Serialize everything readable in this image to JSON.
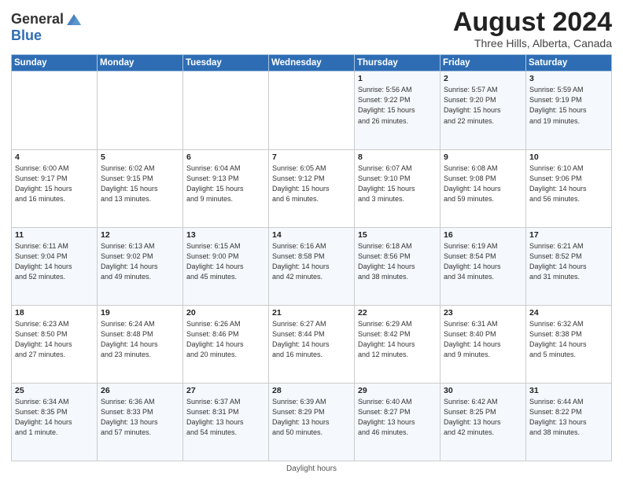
{
  "header": {
    "logo_general": "General",
    "logo_blue": "Blue",
    "main_title": "August 2024",
    "subtitle": "Three Hills, Alberta, Canada"
  },
  "footer": {
    "note": "Daylight hours"
  },
  "calendar": {
    "days_of_week": [
      "Sunday",
      "Monday",
      "Tuesday",
      "Wednesday",
      "Thursday",
      "Friday",
      "Saturday"
    ],
    "weeks": [
      [
        {
          "day": "",
          "info": ""
        },
        {
          "day": "",
          "info": ""
        },
        {
          "day": "",
          "info": ""
        },
        {
          "day": "",
          "info": ""
        },
        {
          "day": "1",
          "info": "Sunrise: 5:56 AM\nSunset: 9:22 PM\nDaylight: 15 hours\nand 26 minutes."
        },
        {
          "day": "2",
          "info": "Sunrise: 5:57 AM\nSunset: 9:20 PM\nDaylight: 15 hours\nand 22 minutes."
        },
        {
          "day": "3",
          "info": "Sunrise: 5:59 AM\nSunset: 9:19 PM\nDaylight: 15 hours\nand 19 minutes."
        }
      ],
      [
        {
          "day": "4",
          "info": "Sunrise: 6:00 AM\nSunset: 9:17 PM\nDaylight: 15 hours\nand 16 minutes."
        },
        {
          "day": "5",
          "info": "Sunrise: 6:02 AM\nSunset: 9:15 PM\nDaylight: 15 hours\nand 13 minutes."
        },
        {
          "day": "6",
          "info": "Sunrise: 6:04 AM\nSunset: 9:13 PM\nDaylight: 15 hours\nand 9 minutes."
        },
        {
          "day": "7",
          "info": "Sunrise: 6:05 AM\nSunset: 9:12 PM\nDaylight: 15 hours\nand 6 minutes."
        },
        {
          "day": "8",
          "info": "Sunrise: 6:07 AM\nSunset: 9:10 PM\nDaylight: 15 hours\nand 3 minutes."
        },
        {
          "day": "9",
          "info": "Sunrise: 6:08 AM\nSunset: 9:08 PM\nDaylight: 14 hours\nand 59 minutes."
        },
        {
          "day": "10",
          "info": "Sunrise: 6:10 AM\nSunset: 9:06 PM\nDaylight: 14 hours\nand 56 minutes."
        }
      ],
      [
        {
          "day": "11",
          "info": "Sunrise: 6:11 AM\nSunset: 9:04 PM\nDaylight: 14 hours\nand 52 minutes."
        },
        {
          "day": "12",
          "info": "Sunrise: 6:13 AM\nSunset: 9:02 PM\nDaylight: 14 hours\nand 49 minutes."
        },
        {
          "day": "13",
          "info": "Sunrise: 6:15 AM\nSunset: 9:00 PM\nDaylight: 14 hours\nand 45 minutes."
        },
        {
          "day": "14",
          "info": "Sunrise: 6:16 AM\nSunset: 8:58 PM\nDaylight: 14 hours\nand 42 minutes."
        },
        {
          "day": "15",
          "info": "Sunrise: 6:18 AM\nSunset: 8:56 PM\nDaylight: 14 hours\nand 38 minutes."
        },
        {
          "day": "16",
          "info": "Sunrise: 6:19 AM\nSunset: 8:54 PM\nDaylight: 14 hours\nand 34 minutes."
        },
        {
          "day": "17",
          "info": "Sunrise: 6:21 AM\nSunset: 8:52 PM\nDaylight: 14 hours\nand 31 minutes."
        }
      ],
      [
        {
          "day": "18",
          "info": "Sunrise: 6:23 AM\nSunset: 8:50 PM\nDaylight: 14 hours\nand 27 minutes."
        },
        {
          "day": "19",
          "info": "Sunrise: 6:24 AM\nSunset: 8:48 PM\nDaylight: 14 hours\nand 23 minutes."
        },
        {
          "day": "20",
          "info": "Sunrise: 6:26 AM\nSunset: 8:46 PM\nDaylight: 14 hours\nand 20 minutes."
        },
        {
          "day": "21",
          "info": "Sunrise: 6:27 AM\nSunset: 8:44 PM\nDaylight: 14 hours\nand 16 minutes."
        },
        {
          "day": "22",
          "info": "Sunrise: 6:29 AM\nSunset: 8:42 PM\nDaylight: 14 hours\nand 12 minutes."
        },
        {
          "day": "23",
          "info": "Sunrise: 6:31 AM\nSunset: 8:40 PM\nDaylight: 14 hours\nand 9 minutes."
        },
        {
          "day": "24",
          "info": "Sunrise: 6:32 AM\nSunset: 8:38 PM\nDaylight: 14 hours\nand 5 minutes."
        }
      ],
      [
        {
          "day": "25",
          "info": "Sunrise: 6:34 AM\nSunset: 8:35 PM\nDaylight: 14 hours\nand 1 minute."
        },
        {
          "day": "26",
          "info": "Sunrise: 6:36 AM\nSunset: 8:33 PM\nDaylight: 13 hours\nand 57 minutes."
        },
        {
          "day": "27",
          "info": "Sunrise: 6:37 AM\nSunset: 8:31 PM\nDaylight: 13 hours\nand 54 minutes."
        },
        {
          "day": "28",
          "info": "Sunrise: 6:39 AM\nSunset: 8:29 PM\nDaylight: 13 hours\nand 50 minutes."
        },
        {
          "day": "29",
          "info": "Sunrise: 6:40 AM\nSunset: 8:27 PM\nDaylight: 13 hours\nand 46 minutes."
        },
        {
          "day": "30",
          "info": "Sunrise: 6:42 AM\nSunset: 8:25 PM\nDaylight: 13 hours\nand 42 minutes."
        },
        {
          "day": "31",
          "info": "Sunrise: 6:44 AM\nSunset: 8:22 PM\nDaylight: 13 hours\nand 38 minutes."
        }
      ]
    ]
  }
}
